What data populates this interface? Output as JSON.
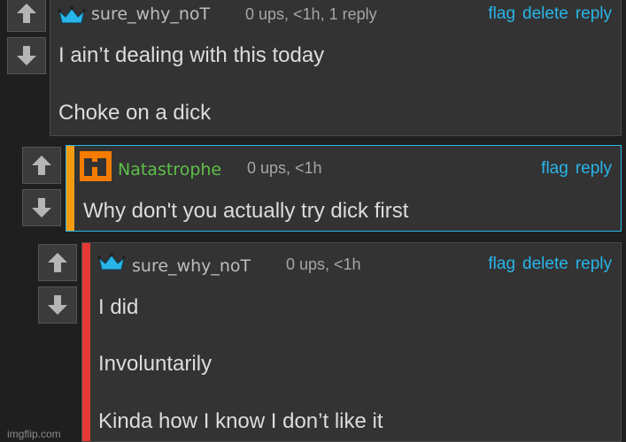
{
  "comments": [
    {
      "username": "sure_why_noT",
      "meta": "0 ups, <1h, 1 reply",
      "actions": [
        "flag",
        "delete",
        "reply"
      ],
      "lines": [
        "I ain’t dealing with this today",
        "Choke on a dick"
      ],
      "avatar_icon": "crown-icon",
      "username_color": "#bdbdbd"
    },
    {
      "username": "Natastrophe",
      "meta": "0 ups, <1h",
      "actions": [
        "flag",
        "reply"
      ],
      "lines": [
        "Why don't you actually try dick first"
      ],
      "avatar_icon": "orange-logo-icon",
      "username_color": "#5fbf4a",
      "bar_color": "#f39c12",
      "border_color": "#29b5e8"
    },
    {
      "username": "sure_why_noT",
      "meta": "0 ups, <1h",
      "actions": [
        "flag",
        "delete",
        "reply"
      ],
      "lines": [
        "I did",
        "Involuntarily",
        "Kinda how I know I don’t like it"
      ],
      "avatar_icon": "crown-icon",
      "username_color": "#bdbdbd",
      "bar_color": "#e53935"
    }
  ],
  "watermark": "imgflip.com"
}
